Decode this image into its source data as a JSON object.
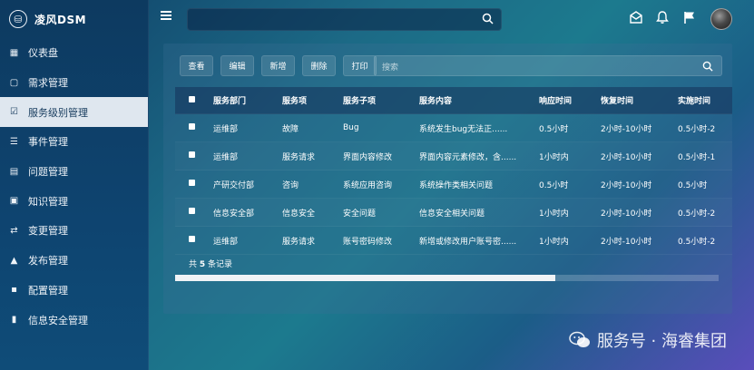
{
  "app": {
    "logo_text": "凌风DSM",
    "logo_glyph": "⛁"
  },
  "sidebar": {
    "items": [
      {
        "label": "仪表盘",
        "icon": "dashboard-icon",
        "glyph": "▦",
        "active": false
      },
      {
        "label": "需求管理",
        "icon": "clipboard-icon",
        "glyph": "▢",
        "active": false
      },
      {
        "label": "服务级别管理",
        "icon": "check-square-icon",
        "glyph": "☑",
        "active": true
      },
      {
        "label": "事件管理",
        "icon": "list-icon",
        "glyph": "☰",
        "active": false
      },
      {
        "label": "问题管理",
        "icon": "grid-icon",
        "glyph": "▤",
        "active": false
      },
      {
        "label": "知识管理",
        "icon": "calendar-check-icon",
        "glyph": "▣",
        "active": false
      },
      {
        "label": "变更管理",
        "icon": "exchange-icon",
        "glyph": "⇄",
        "active": false
      },
      {
        "label": "发布管理",
        "icon": "lock-icon",
        "glyph": "▲",
        "active": false
      },
      {
        "label": "配置管理",
        "icon": "file-icon",
        "glyph": "▪",
        "active": false
      },
      {
        "label": "信息安全管理",
        "icon": "book-icon",
        "glyph": "▮",
        "active": false
      }
    ]
  },
  "topbar": {
    "search_value": ""
  },
  "toolbar": {
    "view": "查看",
    "edit": "编辑",
    "add": "新增",
    "delete": "删除",
    "print": "打印",
    "search_placeholder": "搜索"
  },
  "table": {
    "headers": [
      "服务部门",
      "服务项",
      "服务子项",
      "服务内容",
      "响应时间",
      "恢复时间",
      "实施时间"
    ],
    "rows": [
      [
        "运维部",
        "故障",
        "Bug",
        "系统发生bug无法正......",
        "0.5小时",
        "2小时-10小时",
        "0.5小时-2"
      ],
      [
        "运维部",
        "服务请求",
        "界面内容修改",
        "界面内容元素修改，含......",
        "1小时内",
        "2小时-10小时",
        "0.5小时-1"
      ],
      [
        "产研交付部",
        "咨询",
        "系统应用咨询",
        "系统操作类相关问题",
        "0.5小时",
        "2小时-10小时",
        "0.5小时"
      ],
      [
        "信息安全部",
        "信息安全",
        "安全问题",
        "信息安全相关问题",
        "1小时内",
        "2小时-10小时",
        "0.5小时-2"
      ],
      [
        "运维部",
        "服务请求",
        "账号密码修改",
        "新增或修改用户账号密......",
        "1小时内",
        "2小时-10小时",
        "0.5小时-2"
      ]
    ],
    "footer_prefix": "共 ",
    "footer_count": "5",
    "footer_suffix": " 条记录"
  },
  "scrollbar": {
    "position_fraction": 0.7
  },
  "watermark": {
    "text": "服务号 · 海睿集团"
  },
  "colors": {
    "active_bg": "#dfe7ef",
    "active_text": "#153a5c"
  }
}
